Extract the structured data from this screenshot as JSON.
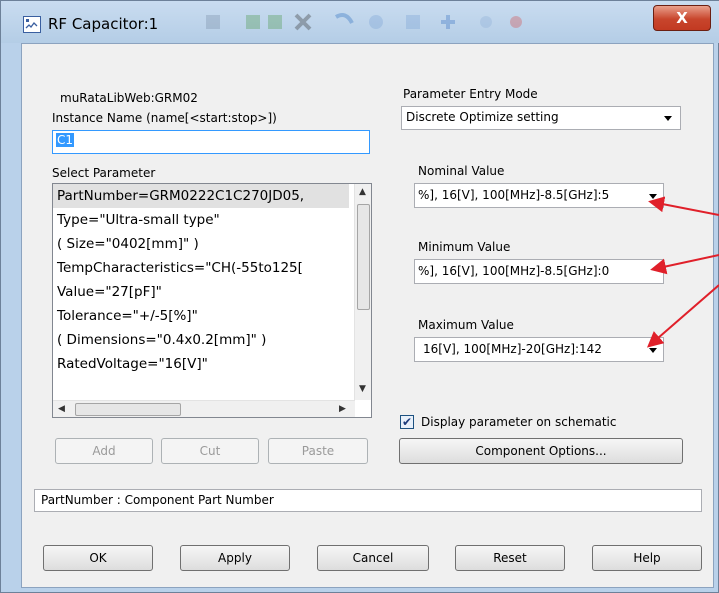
{
  "window": {
    "title": "RF Capacitor:1",
    "close_label": "X"
  },
  "library_label": "muRataLibWeb:GRM02",
  "instance": {
    "label": "Instance Name  (name[<start:stop>])",
    "value": "C1"
  },
  "select_parameter": {
    "label": "Select Parameter",
    "items": [
      "PartNumber=GRM0222C1C270JD05,",
      "Type=\"Ultra-small type\"",
      "( Size=\"0402[mm]\" )",
      "TempCharacteristics=\"CH(-55to125[",
      "Value=\"27[pF]\"",
      "Tolerance=\"+/-5[%]\"",
      "( Dimensions=\"0.4x0.2[mm]\" )",
      "RatedVoltage=\"16[V]\""
    ],
    "selected_index": 0
  },
  "list_buttons": {
    "add": "Add",
    "cut": "Cut",
    "paste": "Paste"
  },
  "param_mode": {
    "label": "Parameter Entry Mode",
    "value": "Discrete Optimize setting"
  },
  "nominal": {
    "label": "Nominal Value",
    "value": "%], 16[V], 100[MHz]-8.5[GHz]:5"
  },
  "minimum": {
    "label": "Minimum Value",
    "value": "%], 16[V], 100[MHz]-8.5[GHz]:0"
  },
  "maximum": {
    "label": "Maximum Value",
    "value": "16[V], 100[MHz]-20[GHz]:142"
  },
  "display_checkbox": {
    "label": "Display parameter on schematic",
    "checked": true
  },
  "component_options_label": "Component Options...",
  "status_text": "PartNumber : Component Part Number",
  "footer_buttons": {
    "ok": "OK",
    "apply": "Apply",
    "cancel": "Cancel",
    "reset": "Reset",
    "help": "Help"
  },
  "colors": {
    "annotation_arrow": "#e0202a"
  }
}
